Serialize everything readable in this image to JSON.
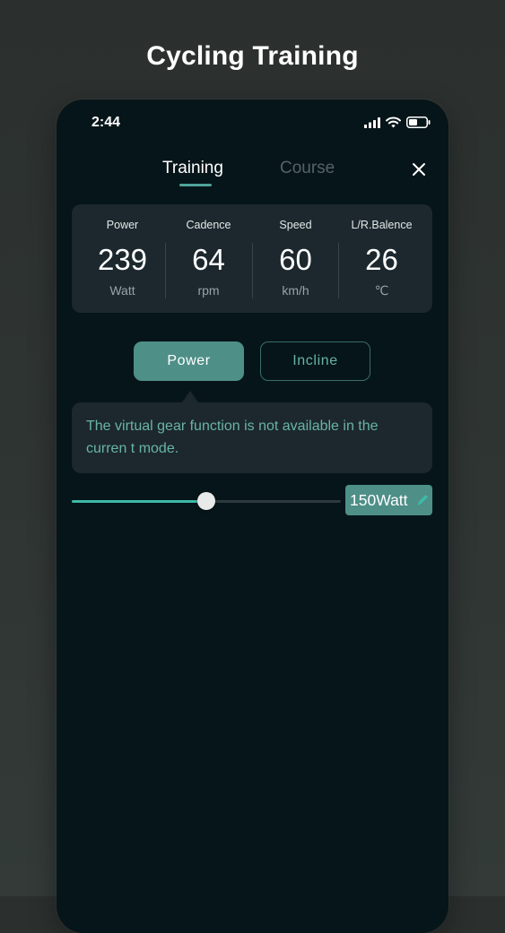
{
  "headline": "Cycling Training",
  "status_bar": {
    "time": "2:44",
    "icons": [
      "signal-icon",
      "wifi-icon",
      "battery-icon"
    ]
  },
  "tabs": {
    "training": "Training",
    "course": "Course",
    "active": "Training",
    "close_icon": "close-icon"
  },
  "metrics": [
    {
      "label": "Power",
      "value": "239",
      "unit": "Watt"
    },
    {
      "label": "Cadence",
      "value": "64",
      "unit": "rpm"
    },
    {
      "label": "Speed",
      "value": "60",
      "unit": "km/h"
    },
    {
      "label": "L/R.Balence",
      "value": "26",
      "unit": "℃"
    }
  ],
  "modes": {
    "power": "Power",
    "incline": "Incline",
    "selected": "Power"
  },
  "tooltip": {
    "message": "The virtual gear function is not available in the curren t mode."
  },
  "slider": {
    "fraction": 0.5,
    "value_text": "150Watt",
    "edit_icon": "pencil-icon"
  },
  "colors": {
    "background": "#2f3533",
    "phone": "#061519",
    "card": "#1c282d",
    "accent": "#4e8f87",
    "slider_fill": "#3eb9a8",
    "tooltip_text": "#6ab3a8"
  }
}
